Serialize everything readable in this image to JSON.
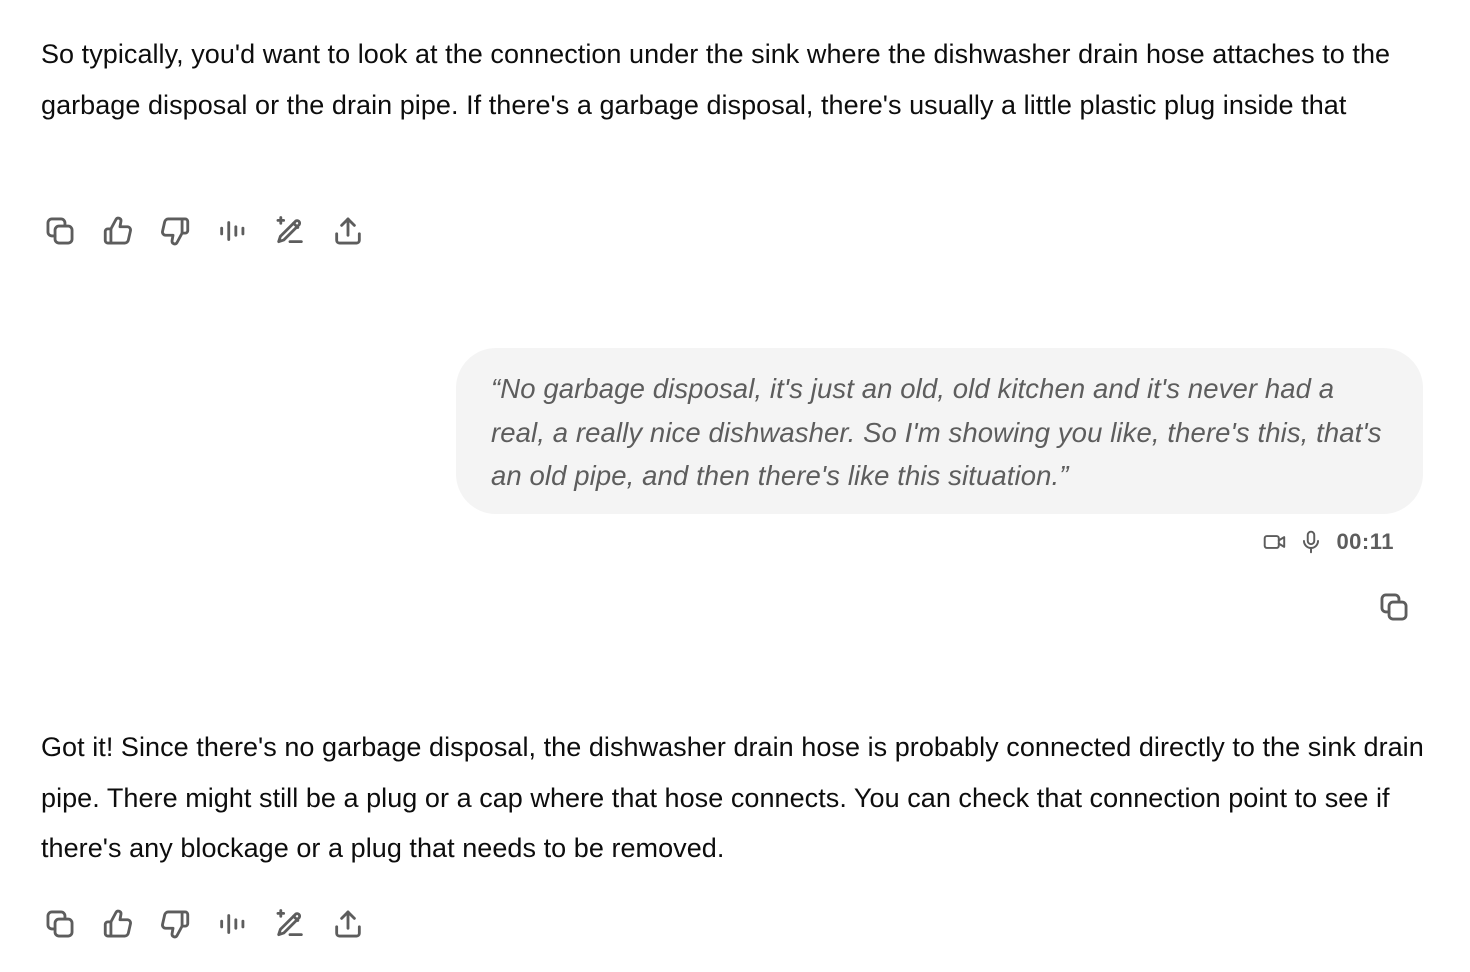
{
  "messages": {
    "assistant_1": {
      "text": "So typically, you'd want to look at the connection under the sink where the dishwasher drain hose attaches to the garbage disposal or the drain pipe. If there's a garbage disposal, there's usually a little plastic plug inside that"
    },
    "user_1": {
      "text": "“No garbage disposal, it's just an old, old kitchen and it's never had a real, a really nice dishwasher. So I'm showing you like, there's this, that's an old pipe, and then there's like this situation.”",
      "duration": "00:11"
    },
    "assistant_2": {
      "text": "Got it! Since there's no garbage disposal, the dishwasher drain hose is probably connected directly to the sink drain pipe. There might still be a plug or a cap where that hose connects. You can check that connection point to see if there's any blockage or a plug that needs to be removed."
    }
  },
  "action_icons": [
    "copy-icon",
    "thumbs-up-icon",
    "thumbs-down-icon",
    "read-aloud-icon",
    "edit-sparkle-icon",
    "share-icon"
  ],
  "voice_meta_icons": [
    "video-icon",
    "microphone-icon"
  ],
  "colors": {
    "text": "#0d0d0d",
    "icon": "#5d5d5d",
    "bubble_bg": "#f4f4f4",
    "user_text": "#5d5d5d"
  }
}
